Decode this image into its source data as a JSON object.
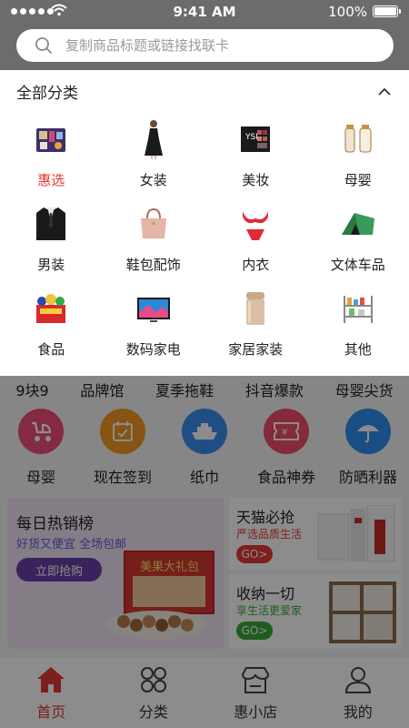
{
  "status_bar": {
    "time": "9:41 AM",
    "battery": "100%"
  },
  "search": {
    "placeholder": "复制商品标题或链接找联卡"
  },
  "categories": {
    "title": "全部分类",
    "items": [
      {
        "label": "惠选",
        "icon": "assorted-goods-icon",
        "active": true
      },
      {
        "label": "女装",
        "icon": "dress-icon"
      },
      {
        "label": "美妆",
        "icon": "makeup-palette-icon"
      },
      {
        "label": "母婴",
        "icon": "baby-bottle-icon"
      },
      {
        "label": "男装",
        "icon": "suit-jacket-icon"
      },
      {
        "label": "鞋包配饰",
        "icon": "handbag-icon"
      },
      {
        "label": "内衣",
        "icon": "lingerie-icon"
      },
      {
        "label": "文体车品",
        "icon": "tent-icon"
      },
      {
        "label": "食品",
        "icon": "snack-box-icon"
      },
      {
        "label": "数码家电",
        "icon": "television-icon"
      },
      {
        "label": "家居家装",
        "icon": "trash-can-icon"
      },
      {
        "label": "其他",
        "icon": "shelf-icon"
      }
    ]
  },
  "quick_links": [
    "9块9",
    "品牌馆",
    "夏季拖鞋",
    "抖音爆款",
    "母婴尖货"
  ],
  "icon_links": [
    {
      "label": "母婴",
      "icon": "stroller-icon",
      "color": "#f04e7a"
    },
    {
      "label": "现在签到",
      "icon": "calendar-check-icon",
      "color": "#f59a23"
    },
    {
      "label": "纸巾",
      "icon": "ship-icon",
      "color": "#3a8ef0"
    },
    {
      "label": "食品神券",
      "icon": "coupon-icon",
      "color": "#f04e6a"
    },
    {
      "label": "防晒利器",
      "icon": "umbrella-icon",
      "color": "#2f8ff0"
    }
  ],
  "promo_main": {
    "title": "每日热销榜",
    "subtitle": "好货又便宜  全场包邮",
    "button": "立即抢购",
    "product_text": "美果大礼包"
  },
  "promo_tmall": {
    "title": "天猫必抢",
    "subtitle": "严选品质生活",
    "button": "GO>",
    "accent": "#e53935"
  },
  "promo_storage": {
    "title": "收纳一切",
    "subtitle": "享生活更爱家",
    "button": "GO>",
    "accent": "#3aa83a"
  },
  "tabbar": [
    {
      "label": "首页",
      "icon": "home-icon",
      "active": true
    },
    {
      "label": "分类",
      "icon": "grid-icon"
    },
    {
      "label": "惠小店",
      "icon": "store-icon"
    },
    {
      "label": "我的",
      "icon": "user-icon"
    }
  ]
}
